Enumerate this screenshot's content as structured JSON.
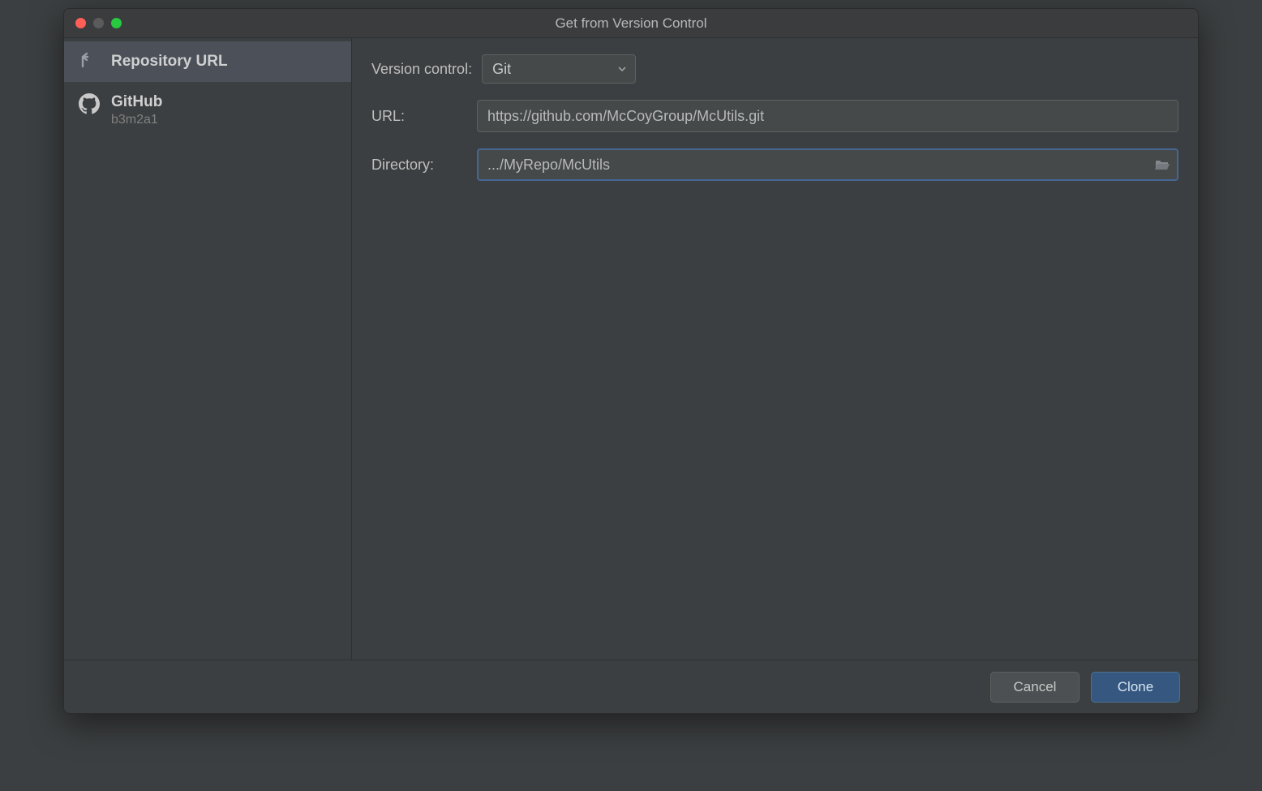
{
  "window": {
    "title": "Get from Version Control"
  },
  "sidebar": {
    "items": [
      {
        "label": "Repository URL",
        "icon": "repo-url-icon"
      },
      {
        "label": "GitHub",
        "sub": "b3m2a1",
        "icon": "github-icon"
      }
    ]
  },
  "form": {
    "version_control_label": "Version control:",
    "version_control_value": "Git",
    "url_label": "URL:",
    "url_value": "https://github.com/McCoyGroup/McUtils.git",
    "directory_label": "Directory:",
    "directory_value": ".../MyRepo/McUtils"
  },
  "footer": {
    "cancel": "Cancel",
    "clone": "Clone"
  },
  "icons": {
    "repo_url": "repo-url-icon",
    "github": "github-icon",
    "chevron_down": "chevron-down-icon",
    "folder_open": "folder-open-icon"
  }
}
